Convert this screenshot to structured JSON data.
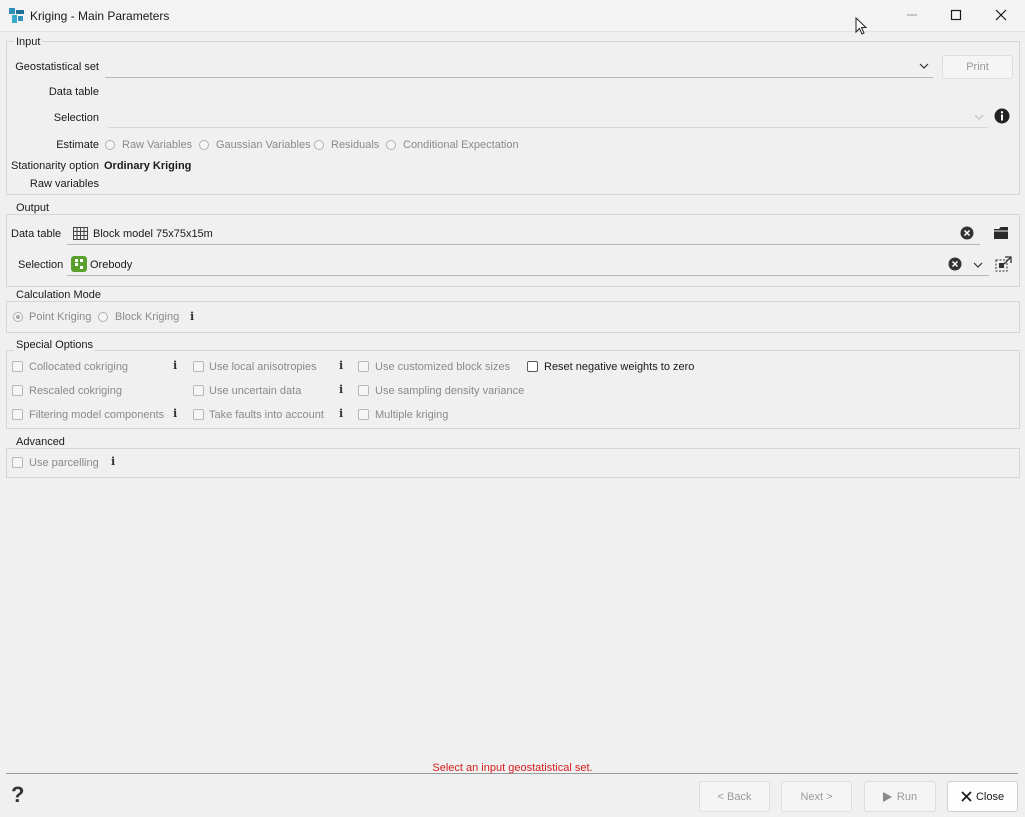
{
  "window": {
    "title": "Kriging - Main Parameters"
  },
  "input": {
    "group_title": "Input",
    "geoset_label": "Geostatistical set",
    "geoset_value": "",
    "print_label": "Print",
    "data_table_label": "Data table",
    "selection_label": "Selection",
    "estimate_label": "Estimate",
    "estimate_options": [
      "Raw Variables",
      "Gaussian Variables",
      "Residuals",
      "Conditional Expectation"
    ],
    "stationarity_label": "Stationarity option",
    "stationarity_value": "Ordinary Kriging",
    "raw_variables_label": "Raw variables"
  },
  "output": {
    "group_title": "Output",
    "data_table_label": "Data table",
    "data_table_value": "Block model 75x75x15m",
    "selection_label": "Selection",
    "selection_value": "Orebody"
  },
  "calc_mode": {
    "group_title": "Calculation Mode",
    "point_label": "Point Kriging",
    "block_label": "Block Kriging"
  },
  "special": {
    "group_title": "Special Options",
    "collocated": "Collocated cokriging",
    "rescaled": "Rescaled cokriging",
    "filtering": "Filtering model components",
    "local_aniso": "Use local anisotropies",
    "uncertain": "Use uncertain data",
    "faults": "Take faults into account",
    "custom_block": "Use customized block sizes",
    "sampling_density": "Use sampling density variance",
    "multiple": "Multiple kriging",
    "reset_negative": "Reset negative weights to zero"
  },
  "advanced": {
    "group_title": "Advanced",
    "parcelling": "Use parcelling"
  },
  "footer": {
    "status": "Select an input geostatistical set.",
    "back": "< Back",
    "next": "Next >",
    "run": "Run",
    "close": "Close"
  },
  "colors": {
    "status_error": "#d42020",
    "accent_green": "#5aa02c",
    "app_icon": "#2f8fb8"
  }
}
